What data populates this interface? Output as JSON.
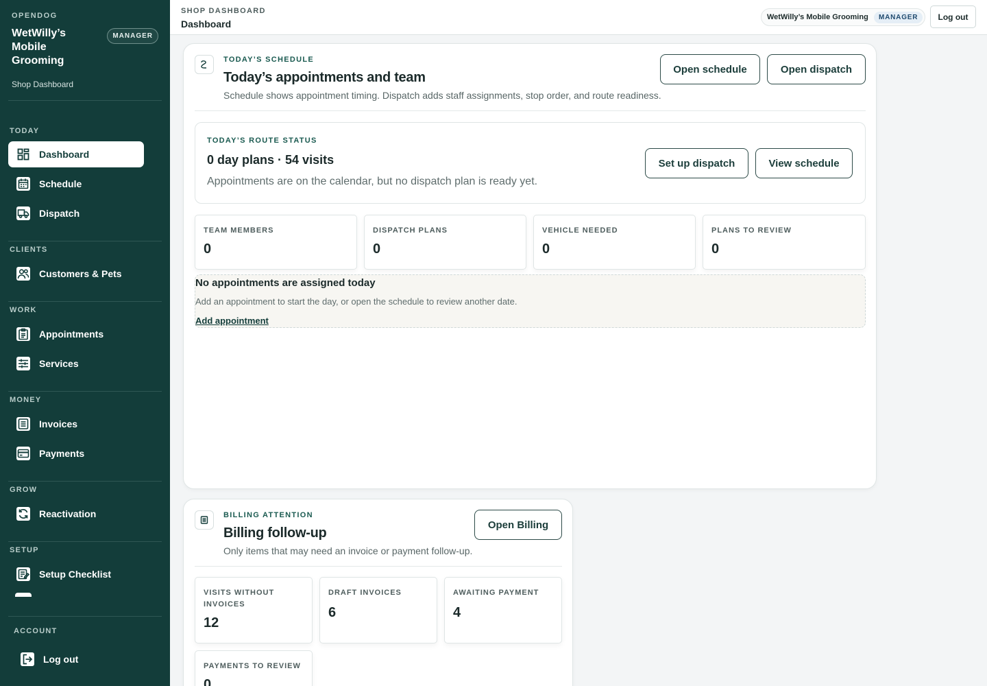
{
  "sidebar": {
    "brand_label": "OPENDOG",
    "shop_name": "WetWilly’s Mobile Grooming",
    "role": "MANAGER",
    "subtitle": "Shop Dashboard",
    "sections": {
      "today": "TODAY",
      "clients": "CLIENTS",
      "work": "WORK",
      "money": "MONEY",
      "grow": "GROW",
      "setup": "SETUP",
      "account": "ACCOUNT"
    },
    "items": {
      "dashboard": "Dashboard",
      "schedule": "Schedule",
      "dispatch": "Dispatch",
      "customers": "Customers & Pets",
      "appointments": "Appointments",
      "services": "Services",
      "invoices": "Invoices",
      "payments": "Payments",
      "reactivation": "Reactivation",
      "setup_checklist": "Setup Checklist",
      "logout": "Log out"
    }
  },
  "topbar": {
    "eyebrow": "SHOP DASHBOARD",
    "title": "Dashboard",
    "shop_name": "WetWilly’s Mobile Grooming",
    "role": "MANAGER",
    "logout": "Log out"
  },
  "schedule_card": {
    "eyebrow": "TODAY’S SCHEDULE",
    "title": "Today’s appointments and team",
    "description": "Schedule shows appointment timing. Dispatch adds staff assignments, stop order, and route readiness.",
    "open_schedule": "Open schedule",
    "open_dispatch": "Open dispatch",
    "route": {
      "eyebrow": "TODAY’S ROUTE STATUS",
      "title": "0 day plans · 54 visits",
      "description": "Appointments are on the calendar, but no dispatch plan is ready yet.",
      "set_up_dispatch": "Set up dispatch",
      "view_schedule": "View schedule"
    },
    "stats": [
      {
        "label": "TEAM MEMBERS",
        "value": "0"
      },
      {
        "label": "DISPATCH PLANS",
        "value": "0"
      },
      {
        "label": "VEHICLE NEEDED",
        "value": "0"
      },
      {
        "label": "PLANS TO REVIEW",
        "value": "0"
      }
    ],
    "empty": {
      "title": "No appointments are assigned today",
      "description": "Add an appointment to start the day, or open the schedule to review another date.",
      "link": "Add appointment"
    }
  },
  "billing_card": {
    "eyebrow": "BILLING ATTENTION",
    "title": "Billing follow-up",
    "description": "Only items that may need an invoice or payment follow-up.",
    "open_billing": "Open Billing",
    "stats": [
      {
        "label": "VISITS WITHOUT INVOICES",
        "value": "12"
      },
      {
        "label": "DRAFT INVOICES",
        "value": "6"
      },
      {
        "label": "AWAITING PAYMENT",
        "value": "4"
      },
      {
        "label": "PAYMENTS TO REVIEW",
        "value": "0"
      }
    ]
  }
}
